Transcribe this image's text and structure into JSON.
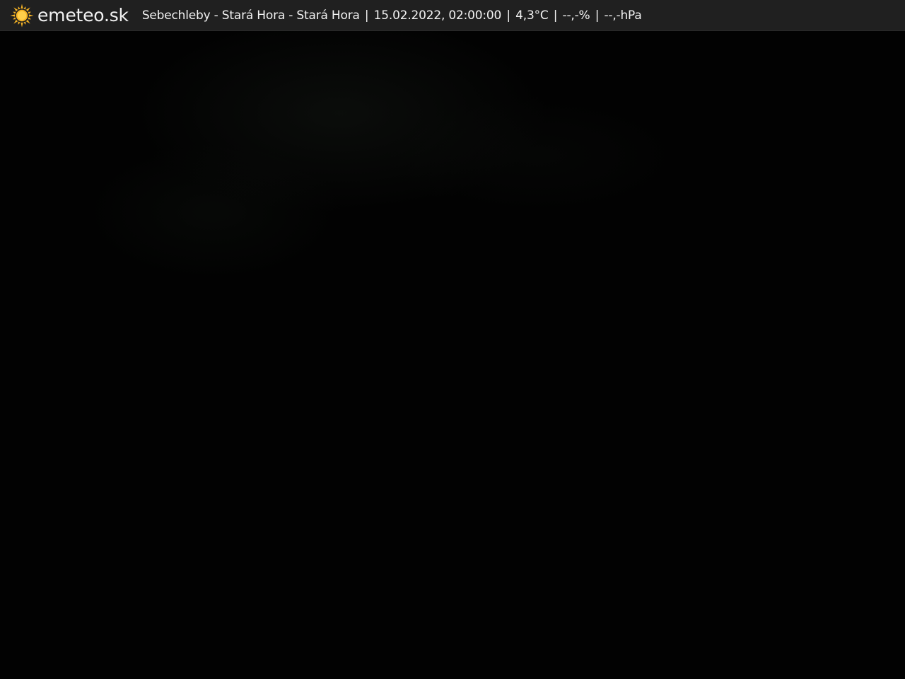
{
  "overlay": {
    "brand": "emeteo.sk",
    "logo_icon": "sun-icon",
    "logo_color": "#f5b325",
    "location": "Sebechleby - Stará Hora - Stará Hora",
    "separator": "|",
    "datetime": "15.02.2022, 02:00:00",
    "temperature": "4,3°C",
    "humidity": "--,-%",
    "pressure": "--,-hPa"
  }
}
